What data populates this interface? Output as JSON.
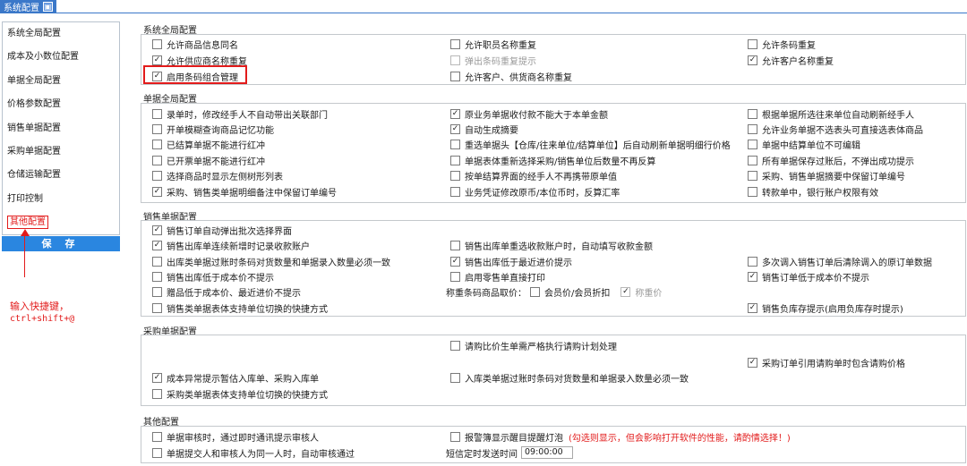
{
  "window": {
    "title": "系统配置",
    "close_symbol": "▣"
  },
  "sidebar": {
    "items": [
      {
        "label": "系统全局配置"
      },
      {
        "label": "成本及小数位配置"
      },
      {
        "label": "单据全局配置"
      },
      {
        "label": "价格参数配置"
      },
      {
        "label": "销售单据配置"
      },
      {
        "label": "采购单据配置"
      },
      {
        "label": "仓储运输配置"
      },
      {
        "label": "打印控制"
      },
      {
        "label": "其他配置"
      }
    ],
    "save_label": "保 存"
  },
  "annotation": {
    "line1": "输入快捷键，",
    "line2": "ctrl+shift+@",
    "color": "#e21b1b"
  },
  "sections": {
    "system": {
      "title": "系统全局配置",
      "options": [
        {
          "label": "允许商品信息同名",
          "checked": false
        },
        {
          "label": "允许职员名称重复",
          "checked": false
        },
        {
          "label": "允许条码重复",
          "checked": false
        },
        {
          "label": "允许供应商名称重复",
          "checked": true
        },
        {
          "label": "弹出条码重复提示",
          "checked": false,
          "disabled": true
        },
        {
          "label": "允许客户名称重复",
          "checked": true
        },
        {
          "label": "启用条码组合管理",
          "checked": true
        },
        {
          "label": "允许客户、供货商名称重复",
          "checked": false
        }
      ]
    },
    "document": {
      "title": "单据全局配置",
      "options": [
        {
          "label": "录单时，修改经手人不自动带出关联部门",
          "checked": false
        },
        {
          "label": "原业务单据收付款不能大于本单金额",
          "checked": true
        },
        {
          "label": "根据单据所选往来单位自动刷新经手人",
          "checked": false
        },
        {
          "label": "开单模糊查询商品记忆功能",
          "checked": false
        },
        {
          "label": "自动生成摘要",
          "checked": true
        },
        {
          "label": "允许业务单据不选表头可直接选表体商品",
          "checked": false
        },
        {
          "label": "已结算单据不能进行红冲",
          "checked": false
        },
        {
          "label": "重选单据头【仓库/往来单位/结算单位】后自动刷新单据明细行价格",
          "checked": false
        },
        {
          "label": "单据中结算单位不可编辑",
          "checked": false
        },
        {
          "label": "已开票单据不能进行红冲",
          "checked": false
        },
        {
          "label": "单据表体重新选择采购/销售单位后数量不再反算",
          "checked": false
        },
        {
          "label": "所有单据保存过账后，不弹出成功提示",
          "checked": false
        },
        {
          "label": "选择商品时显示左侧树形列表",
          "checked": false
        },
        {
          "label": "按单结算界面的经手人不再携带原单值",
          "checked": false
        },
        {
          "label": "采购、销售单据摘要中保留订单编号",
          "checked": false
        },
        {
          "label": "采购、销售类单据明细备注中保留订单编号",
          "checked": true
        },
        {
          "label": "业务凭证修改原币/本位币时，反算汇率",
          "checked": false
        },
        {
          "label": "转款单中，银行账户权限有效",
          "checked": false
        }
      ]
    },
    "sales": {
      "title": "销售单据配置",
      "options": [
        {
          "label": "销售订单自动弹出批次选择界面",
          "checked": true
        },
        {
          "label": "销售出库单连续新增时记录收款账户",
          "checked": true
        },
        {
          "label": "销售出库单重选收款账户时，自动填写收款金额",
          "checked": false
        },
        {
          "label": "出库类单据过账时条码对货数量和单据录入数量必须一致",
          "checked": false
        },
        {
          "label": "销售出库低于最近进价提示",
          "checked": true
        },
        {
          "label": "多次调入销售订单后清除调入的原订单数据",
          "checked": false
        },
        {
          "label": "销售出库低于成本价不提示",
          "checked": false
        },
        {
          "label": "启用零售单直接打印",
          "checked": false
        },
        {
          "label": "销售订单低于成本价不提示",
          "checked": true
        },
        {
          "label": "赠品低于成本价、最近进价不提示",
          "checked": false
        },
        {
          "label": "销售类单据表体支持单位切换的快捷方式",
          "checked": false
        },
        {
          "label": "销售负库存提示(启用负库存时提示)",
          "checked": true
        }
      ],
      "barcode_price_label": "称重条码商品取价：",
      "barcode_options": [
        {
          "label": "会员价/会员折扣",
          "checked": false
        },
        {
          "label": "称重价",
          "checked": true,
          "disabled": true
        }
      ]
    },
    "purchase": {
      "title": "采购单据配置",
      "options": [
        {
          "label": "请购比价生单需严格执行请购计划处理",
          "checked": false
        },
        {
          "label": "采购订单引用请购单时包含请购价格",
          "checked": true
        },
        {
          "label": "成本异常提示暂估入库单、采购入库单",
          "checked": true
        },
        {
          "label": "入库类单据过账时条码对货数量和单据录入数量必须一致",
          "checked": false
        },
        {
          "label": "采购类单据表体支持单位切换的快捷方式",
          "checked": false
        }
      ]
    },
    "other": {
      "title": "其他配置",
      "options": [
        {
          "label": "单据审核时，通过即时通讯提示审核人",
          "checked": false
        },
        {
          "label": "报警簿显示醒目提醒灯泡",
          "checked": false
        },
        {
          "label": "单据提交人和审核人为同一人时，自动审核通过",
          "checked": false
        }
      ],
      "warning": "(勾选则显示，但会影响打开软件的性能，请酌情选择！)",
      "sms_label": "短信定时发送时间",
      "sms_value": "09:00:00"
    }
  }
}
